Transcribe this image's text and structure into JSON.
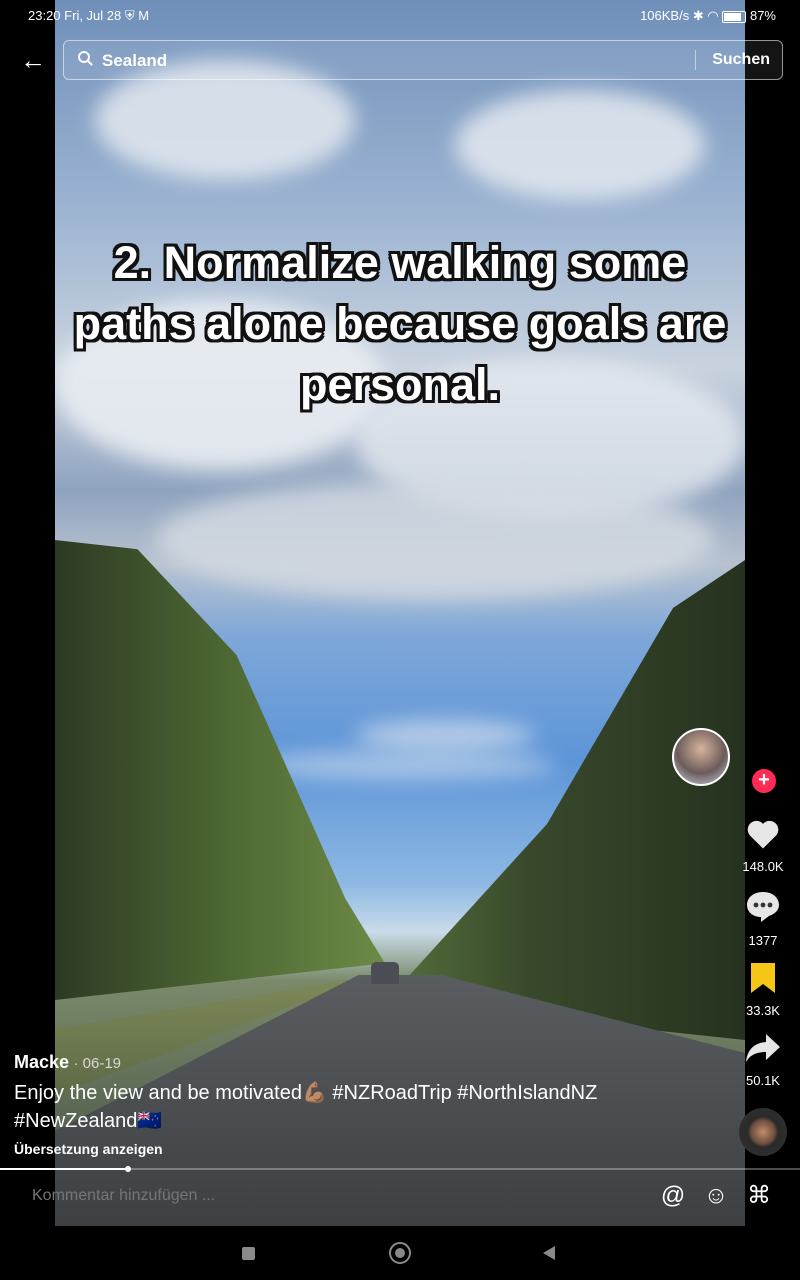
{
  "status_bar": {
    "time": "23:20",
    "date": "Fri, Jul 28",
    "network_speed": "106KB/s",
    "battery": "87%"
  },
  "search": {
    "query": "Sealand",
    "submit_label": "Suchen"
  },
  "video": {
    "overlay_text": "2. Normalize walking some paths alone because goals are personal."
  },
  "actions": {
    "likes": "148.0K",
    "comments": "1377",
    "bookmarks": "33.3K",
    "shares": "50.1K",
    "follow_symbol": "+"
  },
  "post": {
    "author": "Macke",
    "date": "· 06-19",
    "caption": "Enjoy the view and be motivated💪🏽 #NZRoadTrip #NorthIslandNZ #NewZealand🇳🇿",
    "translate_label": "Übersetzung anzeigen",
    "progress": 0.16
  },
  "comment_bar": {
    "placeholder": "Kommentar hinzufügen ..."
  },
  "colors": {
    "follow_badge": "#fe2c55",
    "bookmark_active": "#f5c518"
  }
}
